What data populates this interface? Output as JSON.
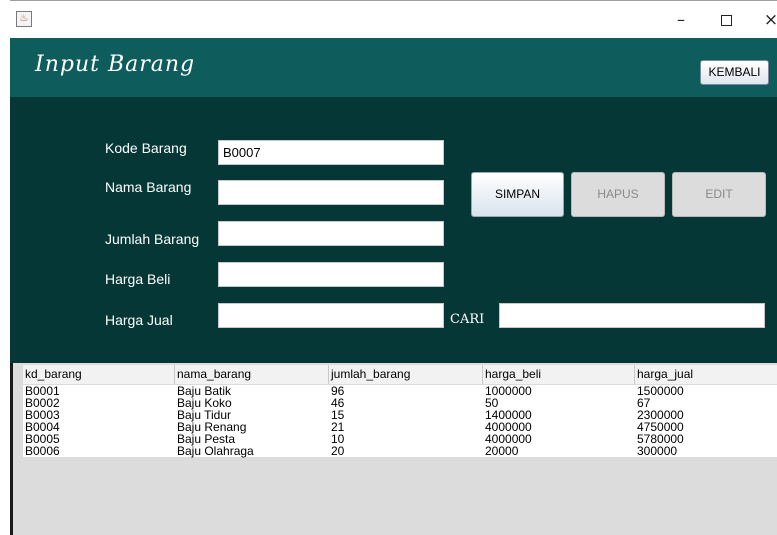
{
  "window": {
    "icon": "java-icon",
    "minimize": "–",
    "maximize": "",
    "close": "×"
  },
  "header": {
    "title": "Input Barang",
    "back_button": "KEMBALI"
  },
  "form": {
    "kode_barang_label": "Kode Barang",
    "kode_barang_value": "B0007",
    "nama_barang_label": "Nama Barang",
    "nama_barang_value": "",
    "jumlah_barang_label": "Jumlah Barang",
    "jumlah_barang_value": "",
    "harga_beli_label": "Harga Beli",
    "harga_beli_value": "",
    "harga_jual_label": "Harga Jual",
    "harga_jual_value": "",
    "cari_label": "CARI",
    "cari_value": ""
  },
  "buttons": {
    "simpan": "SIMPAN",
    "hapus": "HAPUS",
    "edit": "EDIT"
  },
  "table": {
    "columns": [
      "kd_barang",
      "nama_barang",
      "jumlah_barang",
      "harga_beli",
      "harga_jual"
    ],
    "rows": [
      [
        "B0001",
        "Baju Batik",
        "96",
        "1000000",
        "1500000"
      ],
      [
        "B0002",
        "Baju Koko",
        "46",
        "50",
        "67"
      ],
      [
        "B0003",
        "Baju Tidur",
        "15",
        "1400000",
        "2300000"
      ],
      [
        "B0004",
        "Baju Renang",
        "21",
        "4000000",
        "4750000"
      ],
      [
        "B0005",
        "Baju Pesta",
        "10",
        "4000000",
        "5780000"
      ],
      [
        "B0006",
        "Baju Olahraga",
        "20",
        "20000",
        "300000"
      ]
    ]
  }
}
